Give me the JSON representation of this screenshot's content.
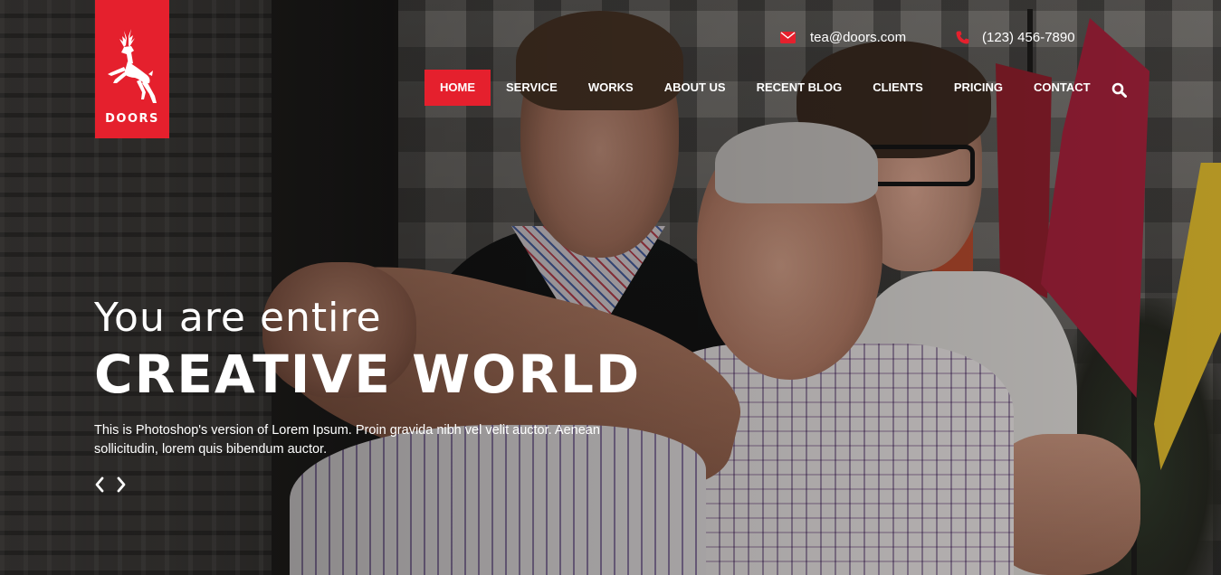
{
  "brand": {
    "name": "DOORS",
    "color": "#e5202d",
    "logo_icon": "deer-icon"
  },
  "contact": {
    "email": "tea@doors.com",
    "email_icon": "envelope-icon",
    "phone": "(123) 456-7890",
    "phone_icon": "phone-icon"
  },
  "nav": {
    "items": [
      {
        "label": "HOME",
        "active": true
      },
      {
        "label": "SERVICE"
      },
      {
        "label": "WORKS"
      },
      {
        "label": "ABOUT US"
      },
      {
        "label": "RECENT BLOG"
      },
      {
        "label": "CLIENTS"
      },
      {
        "label": "PRICING"
      },
      {
        "label": "CONTACT"
      }
    ],
    "search_icon": "search-icon"
  },
  "hero": {
    "subtitle": "You are entire",
    "title": "CREATIVE WORLD",
    "description": "This is Photoshop's version of Lorem Ipsum. Proin gravida nibh vel velit auctor. Aenean sollicitudin, lorem quis bibendum auctor.",
    "prev_icon": "chevron-left-icon",
    "next_icon": "chevron-right-icon"
  }
}
